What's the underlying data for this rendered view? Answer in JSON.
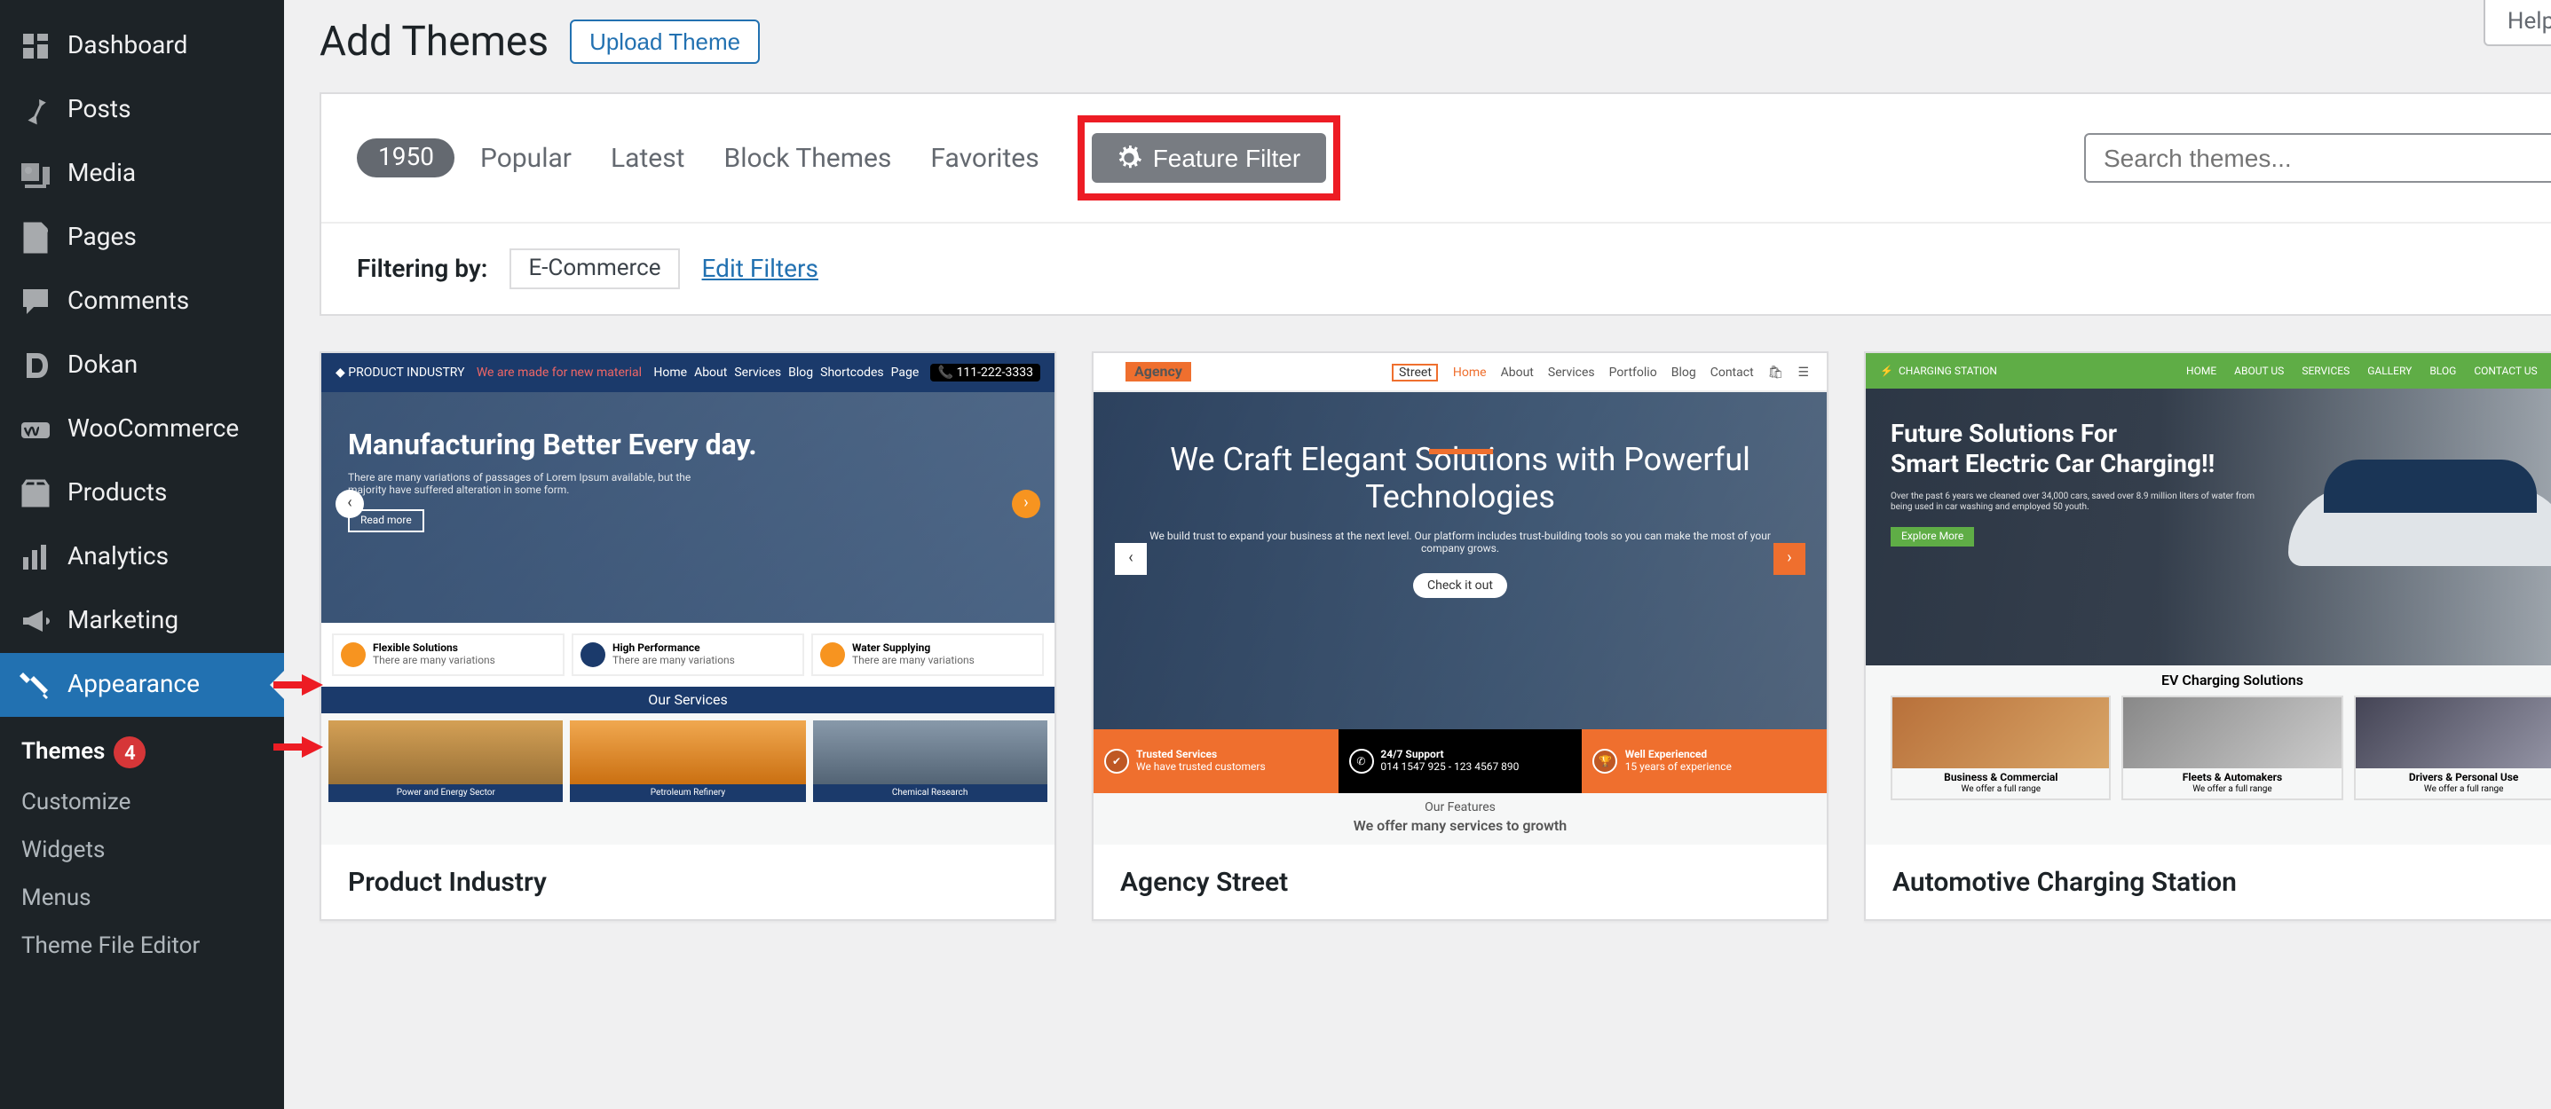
{
  "sidebar": {
    "items": [
      {
        "label": "Dashboard",
        "icon": "dashboard"
      },
      {
        "label": "Posts",
        "icon": "pin"
      },
      {
        "label": "Media",
        "icon": "media"
      },
      {
        "label": "Pages",
        "icon": "page"
      },
      {
        "label": "Comments",
        "icon": "comment"
      },
      {
        "label": "Dokan",
        "icon": "dokan"
      },
      {
        "label": "WooCommerce",
        "icon": "woo"
      },
      {
        "label": "Products",
        "icon": "product"
      },
      {
        "label": "Analytics",
        "icon": "analytics"
      },
      {
        "label": "Marketing",
        "icon": "marketing"
      },
      {
        "label": "Appearance",
        "icon": "appearance"
      }
    ],
    "appearance_sub": [
      {
        "label": "Themes",
        "badge": "4"
      },
      {
        "label": "Customize"
      },
      {
        "label": "Widgets"
      },
      {
        "label": "Menus"
      },
      {
        "label": "Theme File Editor"
      }
    ]
  },
  "header": {
    "title": "Add Themes",
    "upload_label": "Upload Theme",
    "help_label": "Help"
  },
  "filter_bar": {
    "count": "1950",
    "links": [
      "Popular",
      "Latest",
      "Block Themes",
      "Favorites"
    ],
    "feature_filter": "Feature Filter",
    "search_placeholder": "Search themes...",
    "filtering_label": "Filtering by:",
    "tags": [
      "E-Commerce"
    ],
    "edit_filters": "Edit Filters"
  },
  "themes": [
    {
      "name": "Product Industry",
      "hero_title": "Manufacturing Better Every day.",
      "readmore": "Read more",
      "our_services": "Our Services",
      "features": [
        {
          "t": "Flexible Solutions",
          "c": "#f79420"
        },
        {
          "t": "High Performance",
          "c": "#1b3a6b"
        },
        {
          "t": "Water Supplying",
          "c": "#f79420"
        }
      ],
      "imgs": [
        "Power and Energy Sector",
        "Petroleum Refinery",
        "Chemical Research"
      ],
      "nav": [
        "Home",
        "About",
        "Services",
        "Blog",
        "Shortcodes",
        "Page"
      ],
      "brand": "PRODUCT INDUSTRY",
      "phone": "111-222-3333",
      "tagline": "We are made for new material"
    },
    {
      "name": "Agency Street",
      "hero_title": "We Craft Elegant Solutions with Powerful Technologies",
      "sub": "We build trust to expand your business at the next level. Our platform includes trust-building tools so you can make the most of your company grows.",
      "check": "Check it out",
      "band": [
        {
          "t": "Trusted Services",
          "s": "We have trusted customers"
        },
        {
          "t": "24/7 Support",
          "s": "014 1547 925 - 123 4567 890"
        },
        {
          "t": "Well Experienced",
          "s": "15 years of experience"
        }
      ],
      "features_label": "Our Features",
      "tagline2": "We offer many services to growth",
      "nav": [
        "Home",
        "About",
        "Services",
        "Portfolio",
        "Blog",
        "Contact"
      ],
      "brand": "Agency",
      "brand2": "Street"
    },
    {
      "name": "Automotive Charging Station",
      "h1": "Future Solutions For",
      "h2": "Smart Electric Car Charging!!",
      "sub": "Over the past 6 years we cleaned over 34,000 cars, saved over 8.9 million liters of water from being used in car washing and employed 50 youth.",
      "btn": "Explore More",
      "sols": "EV Charging Solutions",
      "cards": [
        {
          "t": "Business & Commercial"
        },
        {
          "t": "Fleets & Automakers"
        },
        {
          "t": "Drivers & Personal Use"
        }
      ],
      "nav": [
        "HOME",
        "ABOUT US",
        "SERVICES",
        "GALLERY",
        "BLOG",
        "CONTACT US"
      ],
      "brand": "CHARGING STATION"
    }
  ]
}
